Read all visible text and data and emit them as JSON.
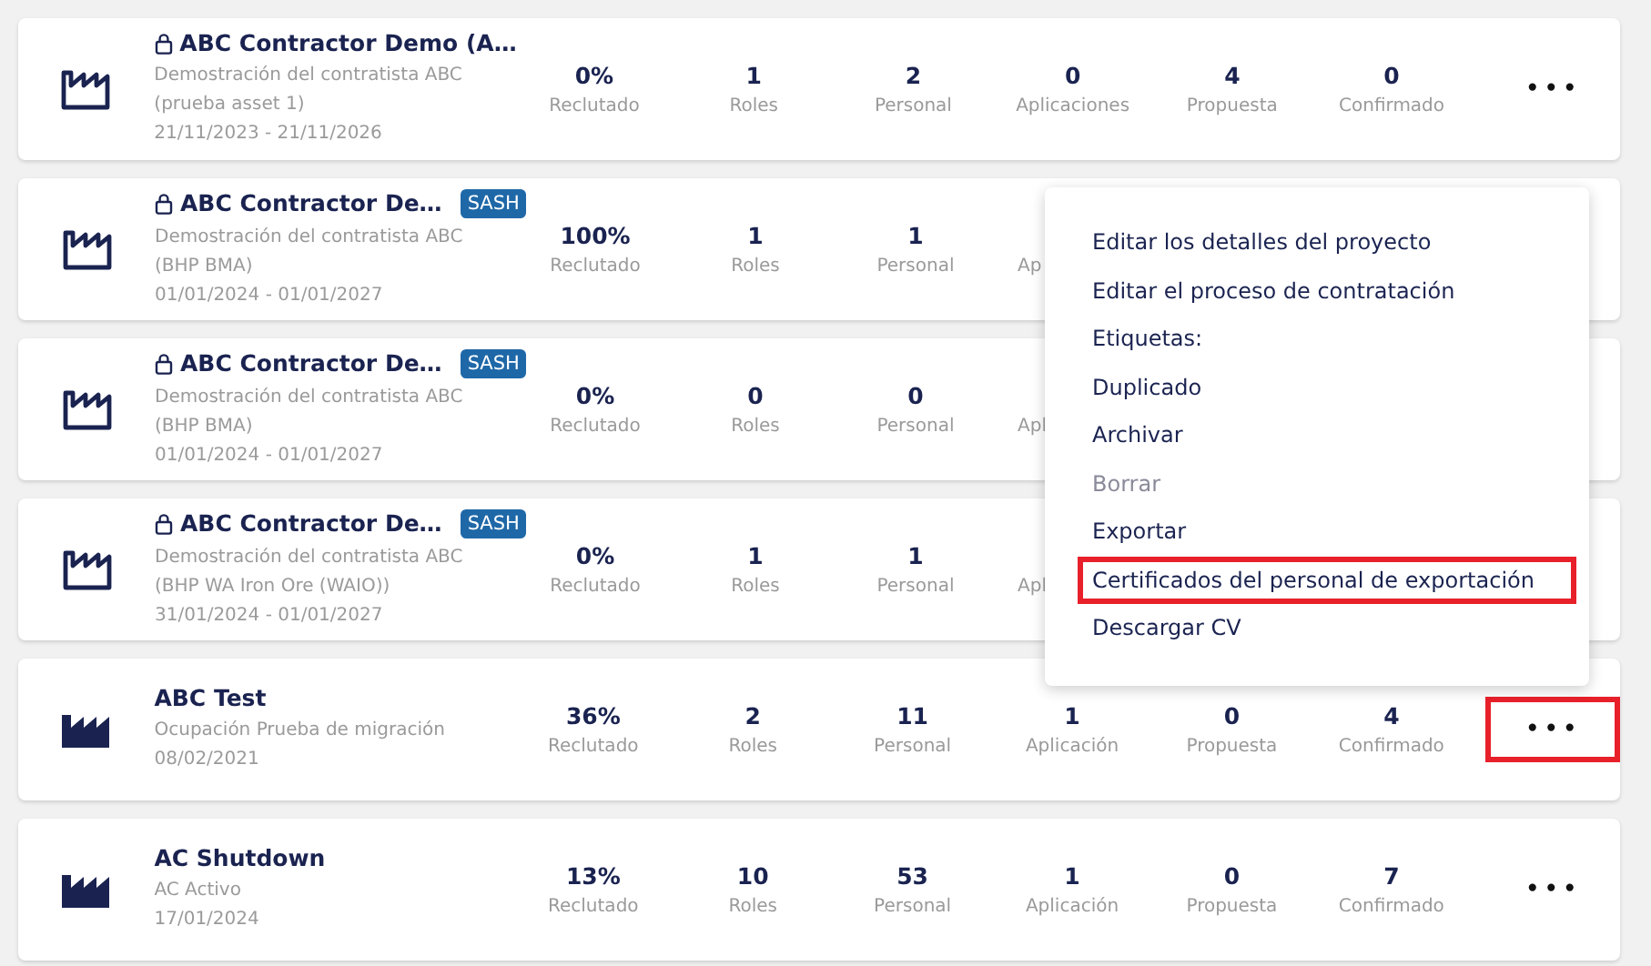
{
  "projects": [
    {
      "title": "ABC Contractor Demo (A…",
      "locked": true,
      "kind": "outline",
      "description": "Demostración del contratista ABC (prueba asset 1)",
      "dates": "21/11/2023 - 21/11/2026",
      "stats": [
        {
          "value": "0%",
          "label": "Reclutado"
        },
        {
          "value": "1",
          "label": "Roles"
        },
        {
          "value": "2",
          "label": "Personal"
        },
        {
          "value": "0",
          "label": "Aplicaciones"
        },
        {
          "value": "4",
          "label": "Propuesta"
        },
        {
          "value": "0",
          "label": "Confirmado"
        }
      ],
      "menu_button": {
        "label": "•••",
        "highlighted": false
      }
    },
    {
      "title": "ABC Contractor De…",
      "locked": true,
      "badge": "SASH",
      "kind": "outline",
      "description": "Demostración del contratista ABC (BHP BMA)",
      "dates": "01/01/2024 - 01/01/2027",
      "stats": [
        {
          "value": "100%",
          "label": "Reclutado"
        },
        {
          "value": "1",
          "label": "Roles"
        },
        {
          "value": "1",
          "label": "Personal"
        },
        {
          "label": "Ap",
          "kind": "cut"
        }
      ]
    },
    {
      "title": "ABC Contractor De…",
      "locked": true,
      "badge": "SASH",
      "kind": "outline",
      "description": "Demostración del contratista ABC (BHP BMA)",
      "dates": "01/01/2024 - 01/01/2027",
      "stats": [
        {
          "value": "0%",
          "label": "Reclutado"
        },
        {
          "value": "0",
          "label": "Roles"
        },
        {
          "value": "0",
          "label": "Personal"
        },
        {
          "label": "Apl",
          "kind": "cut"
        }
      ]
    },
    {
      "title": "ABC Contractor De…",
      "locked": true,
      "badge": "SASH",
      "kind": "outline",
      "description": "Demostración del contratista ABC (BHP WA Iron Ore (WAIO))",
      "dates": "31/01/2024 - 01/01/2027",
      "stats": [
        {
          "value": "0%",
          "label": "Reclutado"
        },
        {
          "value": "1",
          "label": "Roles"
        },
        {
          "value": "1",
          "label": "Personal"
        },
        {
          "label": "Apl",
          "kind": "cut"
        }
      ]
    },
    {
      "title": "ABC Test",
      "locked": false,
      "kind": "filled",
      "description": "Ocupación Prueba de migración",
      "dates": "08/02/2021",
      "stats": [
        {
          "value": "36%",
          "label": "Reclutado"
        },
        {
          "value": "2",
          "label": "Roles"
        },
        {
          "value": "11",
          "label": "Personal"
        },
        {
          "value": "1",
          "label": "Aplicación"
        },
        {
          "value": "0",
          "label": "Propuesta"
        },
        {
          "value": "4",
          "label": "Confirmado"
        }
      ],
      "menu_button": {
        "label": "•••",
        "highlighted": true
      }
    },
    {
      "title": "AC Shutdown",
      "locked": false,
      "kind": "filled",
      "description": "AC Activo",
      "dates": "17/01/2024",
      "stats": [
        {
          "value": "13%",
          "label": "Reclutado"
        },
        {
          "value": "10",
          "label": "Roles"
        },
        {
          "value": "53",
          "label": "Personal"
        },
        {
          "value": "1",
          "label": "Aplicación"
        },
        {
          "value": "0",
          "label": "Propuesta"
        },
        {
          "value": "7",
          "label": "Confirmado"
        }
      ],
      "menu_button": {
        "label": "•••",
        "highlighted": false
      }
    }
  ],
  "menu": {
    "items": [
      {
        "label": "Editar los detalles del proyecto",
        "disabled": false,
        "highlighted": false
      },
      {
        "label": "Editar el proceso de contratación",
        "disabled": false,
        "highlighted": false
      },
      {
        "label": "Etiquetas:",
        "disabled": false,
        "highlighted": false
      },
      {
        "label": "Duplicado",
        "disabled": false,
        "highlighted": false
      },
      {
        "label": "Archivar",
        "disabled": false,
        "highlighted": false
      },
      {
        "label": "Borrar",
        "disabled": true,
        "highlighted": false
      },
      {
        "label": "Exportar",
        "disabled": false,
        "highlighted": false
      },
      {
        "label": "Certificados del personal de exportación",
        "disabled": false,
        "highlighted": true
      },
      {
        "label": "Descargar CV",
        "disabled": false,
        "highlighted": false
      }
    ]
  }
}
